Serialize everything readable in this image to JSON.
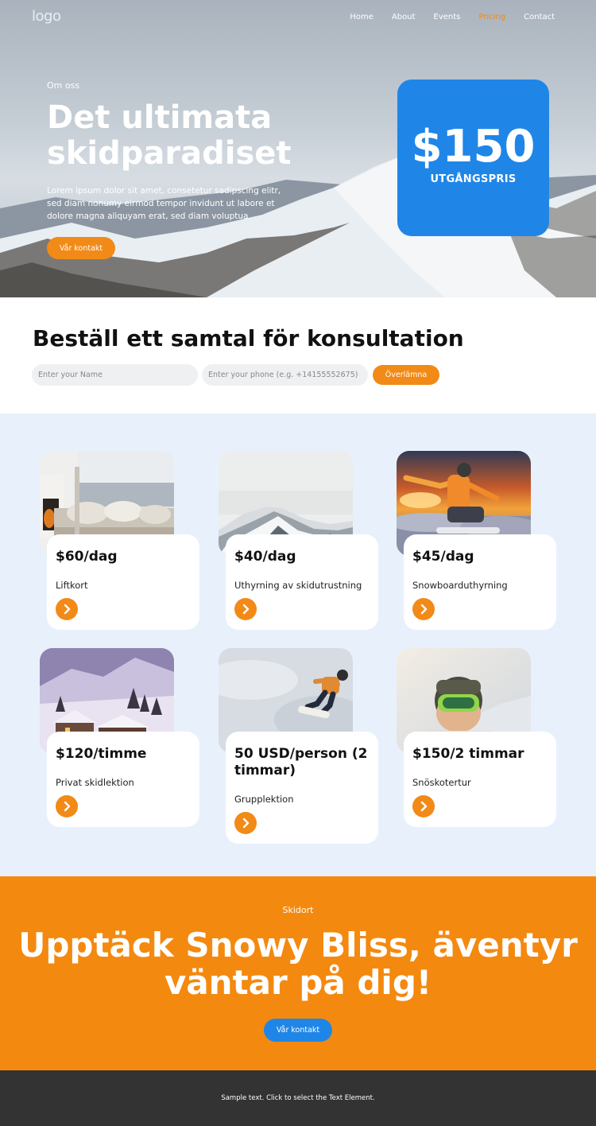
{
  "header": {
    "logo": "logo",
    "nav": [
      {
        "label": "Home"
      },
      {
        "label": "About"
      },
      {
        "label": "Events"
      },
      {
        "label": "Pricing"
      },
      {
        "label": "Contact"
      }
    ],
    "active_nav": "Pricing"
  },
  "hero": {
    "eyebrow": "Om oss",
    "title": "Det ultimata skidparadiset",
    "text": "Lorem ipsum dolor sit amet, consetetur sadipscing elitr, sed diam nonumy eirmod tempor invidunt ut labore et dolore magna aliquyam erat, sed diam voluptua.",
    "button": "Vår kontakt",
    "price": "$150",
    "price_label": "UTGÅNGSPRIS"
  },
  "consult": {
    "title": "Beställ ett samtal för konsultation",
    "name_placeholder": "Enter your Name",
    "phone_placeholder": "Enter your phone (e.g. +14155552675)",
    "submit": "Överlämna"
  },
  "cards": [
    {
      "price": "$60/dag",
      "name": "Liftkort",
      "image": "cozy-cabin-interior"
    },
    {
      "price": "$40/dag",
      "name": "Uthyrning av skidutrustning",
      "image": "snowy-peaks"
    },
    {
      "price": "$45/dag",
      "name": "Snowboarduthyrning",
      "image": "snowboarder-sunset"
    },
    {
      "price": "$120/timme",
      "name": "Privat skidlektion",
      "image": "snowy-village-twilight"
    },
    {
      "price": "50 USD/person (2 timmar)",
      "name": "Grupplektion",
      "image": "snowboard-jump"
    },
    {
      "price": "$150/2 timmar",
      "name": "Snöskotertur",
      "image": "skier-goggles"
    }
  ],
  "cta": {
    "eyebrow": "Skidort",
    "title": "Upptäck Snowy Bliss, äventyr väntar på dig!",
    "button": "Vår kontakt"
  },
  "footer": {
    "text": "Sample text. Click to select the Text Element."
  },
  "colors": {
    "accent_orange": "#f28a17",
    "accent_blue": "#1f86e8",
    "cards_bg": "#e8f1fb",
    "footer_bg": "#333333"
  }
}
